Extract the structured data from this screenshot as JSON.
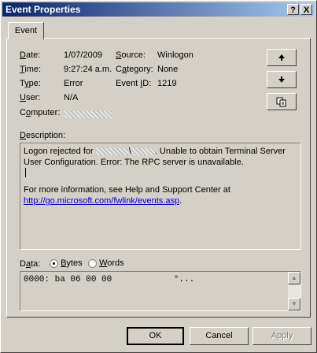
{
  "window": {
    "title": "Event Properties",
    "help_btn": "?",
    "close_btn": "X"
  },
  "tab": {
    "label": "Event"
  },
  "fields": {
    "date_label": "Date:",
    "date_value": "1/07/2009",
    "time_label": "Time:",
    "time_value": "9:27:24 a.m.",
    "type_label": "Type:",
    "type_value": "Error",
    "user_label": "User:",
    "user_value": "N/A",
    "computer_label": "Computer:",
    "source_label": "Source:",
    "source_value": "Winlogon",
    "category_label": "Category:",
    "category_value": "None",
    "eventid_label": "Event ID:",
    "eventid_value": "1219"
  },
  "nav": {
    "up_icon": "arrow-up-icon",
    "down_icon": "arrow-down-icon",
    "copy_icon": "copy-icon"
  },
  "description": {
    "label": "Description:",
    "line1_pre": "Logon rejected for",
    "line1_sep": "\\",
    "line1_post": ". Unable to obtain Terminal Server",
    "line2": "User Configuration. Error: The RPC server is unavailable.",
    "line3": "For more information, see Help and Support Center at",
    "link": "http://go.microsoft.com/fwlink/events.asp",
    "link_dot": "."
  },
  "data_section": {
    "label": "Data:",
    "bytes_label": "Bytes",
    "words_label": "Words",
    "selected": "Bytes",
    "line1_hex": "0000: ba 06 00 00",
    "line1_ascii": "°..."
  },
  "buttons": {
    "ok": "OK",
    "cancel": "Cancel",
    "apply": "Apply"
  }
}
